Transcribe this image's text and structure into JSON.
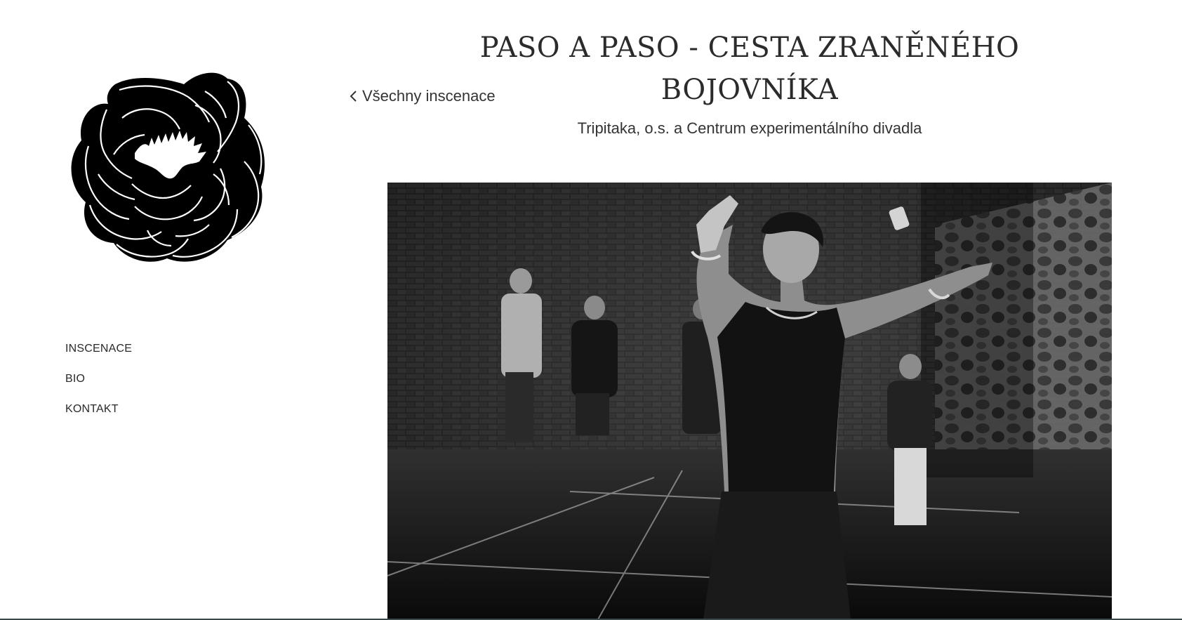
{
  "logo": {
    "icon": "peony-flower-logo-icon"
  },
  "nav": {
    "items": [
      {
        "label": "INSCENACE"
      },
      {
        "label": "BIO"
      },
      {
        "label": "KONTAKT"
      }
    ]
  },
  "back_link": {
    "label": "Všechny inscenace",
    "icon": "chevron-left-icon"
  },
  "production": {
    "title": "PASO A PASO - CESTA ZRANĚNÉHO BOJOVNÍKA",
    "subtitle": "Tripitaka, o.s. a Centrum experimentálního divadla"
  },
  "photo": {
    "icon": "performance-photo-icon"
  },
  "colors": {
    "background": "#ffffff",
    "text": "#2b2b2b",
    "logo": "#000000"
  }
}
